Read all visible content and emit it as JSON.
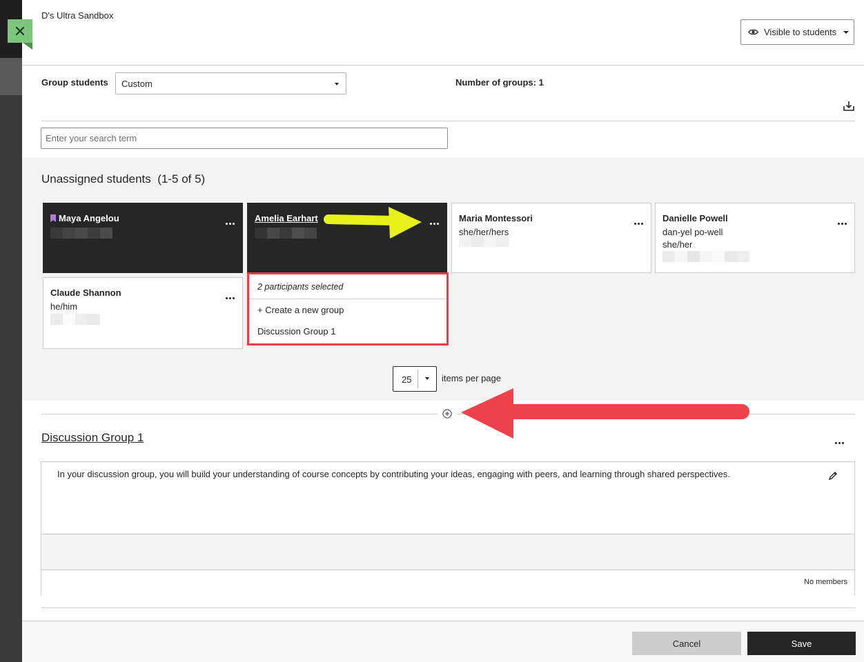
{
  "course": {
    "title": "D's Ultra Sandbox"
  },
  "visibility": {
    "label": "Visible to students",
    "icon": "eye-icon"
  },
  "grouping": {
    "label": "Group students",
    "selected": "Custom",
    "number_of_groups_label": "Number of groups: 1"
  },
  "search": {
    "placeholder": "Enter your search term"
  },
  "unassigned": {
    "title": "Unassigned students",
    "range": "(1-5 of 5)",
    "students": [
      {
        "name": "Maya Angelou",
        "pronouns": "",
        "pronunciation": "",
        "selected": true,
        "flag_color": "#b07cd6"
      },
      {
        "name": "Amelia Earhart",
        "pronouns": "",
        "pronunciation": "",
        "selected": true
      },
      {
        "name": "Maria Montessori",
        "pronouns": "she/her/hers",
        "pronunciation": "",
        "selected": false
      },
      {
        "name": "Danielle Powell",
        "pronouns": "she/her",
        "pronunciation": "dan-yel po-well",
        "selected": false
      },
      {
        "name": "Claude Shannon",
        "pronouns": "he/him",
        "pronunciation": "",
        "selected": false
      }
    ]
  },
  "menu": {
    "header": "2 participants selected",
    "items": [
      "+ Create a new group",
      "Discussion Group 1"
    ]
  },
  "pagination": {
    "per_page_value": "25",
    "per_page_label": "items per page"
  },
  "group": {
    "title": "Discussion Group 1",
    "description": "In your discussion group, you will build your understanding of course concepts by contributing your ideas, engaging with peers, and learning through shared perspectives.",
    "members_label": "No members"
  },
  "footer": {
    "cancel_label": "Cancel",
    "save_label": "Save"
  },
  "annotations": {
    "yellow_arrow_color": "#e6f21a",
    "red_arrow_color": "#f0424a",
    "highlight_box_color": "#e8404a"
  }
}
